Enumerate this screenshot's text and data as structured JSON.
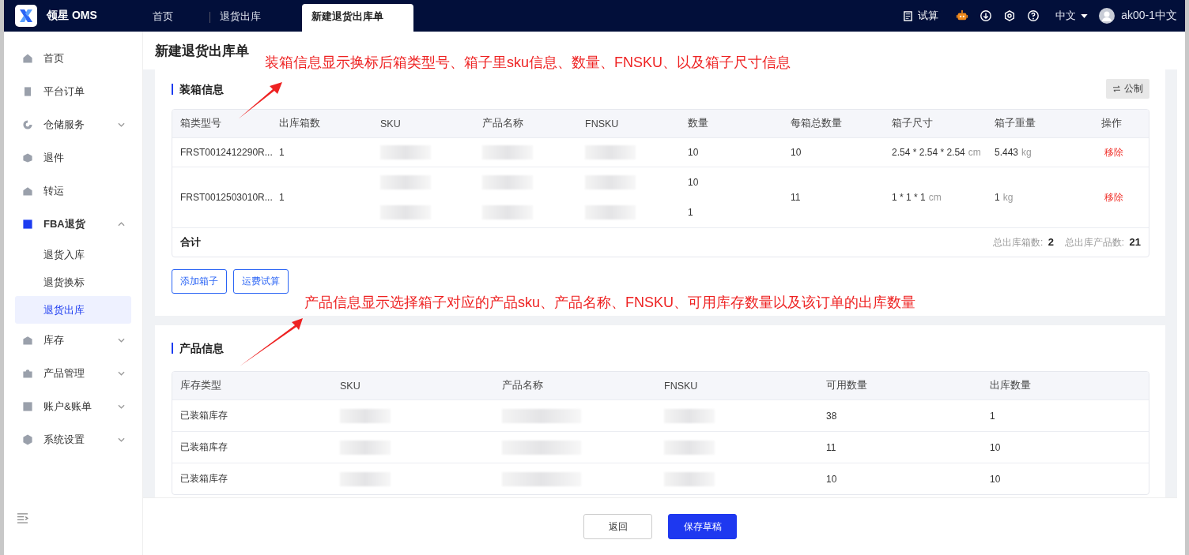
{
  "app": {
    "name": "领星 OMS"
  },
  "tabs": [
    {
      "label": "首页",
      "selected": false
    },
    {
      "label": "退货出库",
      "selected": false
    },
    {
      "label": "新建退货出库单",
      "selected": true
    }
  ],
  "header": {
    "trial": "试算",
    "language": "中文",
    "user": "ak00-1中文"
  },
  "sidebar": {
    "items": [
      {
        "label": "首页",
        "selected": false
      },
      {
        "label": "平台订单",
        "selected": false
      },
      {
        "label": "仓储服务",
        "selected": false,
        "expanded": false
      },
      {
        "label": "退件",
        "selected": false
      },
      {
        "label": "转运",
        "selected": false
      },
      {
        "label": "FBA退货",
        "selected": false,
        "expanded": true,
        "children": [
          {
            "label": "退货入库",
            "selected": false
          },
          {
            "label": "退货换标",
            "selected": false
          },
          {
            "label": "退货出库",
            "selected": true
          }
        ]
      },
      {
        "label": "库存",
        "selected": false,
        "expanded": false
      },
      {
        "label": "产品管理",
        "selected": false,
        "expanded": false
      },
      {
        "label": "账户&账单",
        "selected": false,
        "expanded": false
      },
      {
        "label": "系统设置",
        "selected": false,
        "expanded": false
      }
    ]
  },
  "page_title": "新建退货出库单",
  "annotations": [
    {
      "text": "装箱信息显示换标后箱类型号、箱子里sku信息、数量、FNSKU、以及箱子尺寸信息"
    },
    {
      "text": "产品信息显示选择箱子对应的产品sku、产品名称、FNSKU、可用库存数量以及该订单的出库数量"
    }
  ],
  "packing": {
    "title": "装箱信息",
    "unit_button": "公制",
    "columns": [
      "箱类型号",
      "出库箱数",
      "SKU",
      "产品名称",
      "FNSKU",
      "数量",
      "每箱总数量",
      "箱子尺寸",
      "箱子重量",
      "操作"
    ],
    "rows": [
      {
        "box_type": "FRST0012412290R...",
        "box_count": "1",
        "items": [
          {
            "sku": {
              "kind": "blurred"
            },
            "name": {
              "kind": "blurred"
            },
            "fnsku": {
              "kind": "blurred"
            },
            "qty": "10"
          }
        ],
        "per_box_total": "10",
        "size": "2.54 * 2.54 * 2.54",
        "size_unit": "cm",
        "weight": "5.443",
        "weight_unit": "kg",
        "action": "移除"
      },
      {
        "box_type": "FRST0012503010R...",
        "box_count": "1",
        "items": [
          {
            "sku": {
              "kind": "blurred"
            },
            "name": {
              "kind": "blurred"
            },
            "fnsku": {
              "kind": "blurred"
            },
            "qty": "10"
          },
          {
            "sku": {
              "kind": "blurred"
            },
            "name": {
              "kind": "blurred"
            },
            "fnsku": {
              "kind": "blurred"
            },
            "qty": "1"
          }
        ],
        "per_box_total": "11",
        "size": "1 * 1 * 1",
        "size_unit": "cm",
        "weight": "1",
        "weight_unit": "kg",
        "action": "移除"
      }
    ],
    "total": {
      "label": "合计",
      "box_label": "总出库箱数:",
      "box_value": "2",
      "product_label": "总出库产品数:",
      "product_value": "21"
    },
    "buttons": [
      "添加箱子",
      "运费试算"
    ]
  },
  "products": {
    "title": "产品信息",
    "columns": [
      "库存类型",
      "SKU",
      "产品名称",
      "FNSKU",
      "可用数量",
      "出库数量"
    ],
    "rows": [
      {
        "type": "已装箱库存",
        "sku": {
          "kind": "blurred"
        },
        "name": {
          "kind": "blurred"
        },
        "fnsku": {
          "kind": "blurred"
        },
        "available": "38",
        "out": "1"
      },
      {
        "type": "已装箱库存",
        "sku": {
          "kind": "blurred"
        },
        "name": {
          "kind": "blurred"
        },
        "fnsku": {
          "kind": "blurred"
        },
        "available": "11",
        "out": "10"
      },
      {
        "type": "已装箱库存",
        "sku": {
          "kind": "blurred"
        },
        "name": {
          "kind": "blurred"
        },
        "fnsku": {
          "kind": "blurred"
        },
        "available": "10",
        "out": "10"
      }
    ]
  },
  "footer": {
    "buttons": [
      {
        "label": "返回",
        "kind": "default"
      },
      {
        "label": "保存草稿",
        "kind": "primary"
      }
    ]
  }
}
